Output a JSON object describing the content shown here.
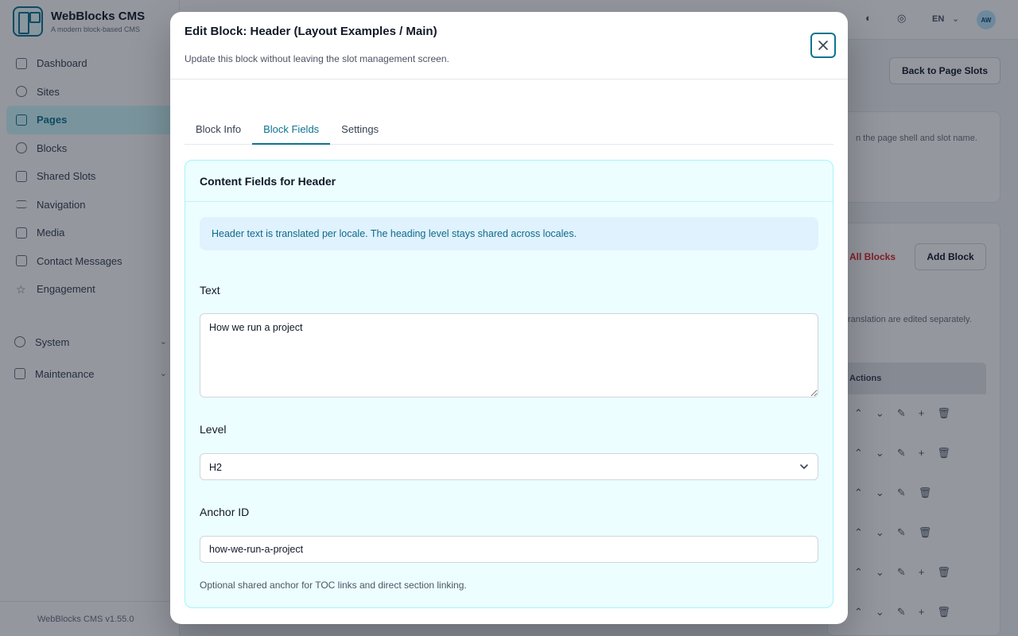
{
  "app": {
    "brand_name": "WebBlocks CMS",
    "brand_tagline": "A modern block-based CMS",
    "version": "WebBlocks CMS v1.55.0",
    "nav": [
      {
        "label": "Dashboard",
        "icon": "grid-icon"
      },
      {
        "label": "Sites",
        "icon": "globe-icon"
      },
      {
        "label": "Pages",
        "icon": "file-icon",
        "active": true
      },
      {
        "label": "Blocks",
        "icon": "blocks-icon"
      },
      {
        "label": "Shared Slots",
        "icon": "layers-icon"
      },
      {
        "label": "Navigation",
        "icon": "menu-icon"
      },
      {
        "label": "Media",
        "icon": "image-icon"
      },
      {
        "label": "Contact Messages",
        "icon": "mail-icon"
      },
      {
        "label": "Engagement",
        "icon": "star-icon"
      }
    ],
    "nav_groups": [
      {
        "label": "System"
      },
      {
        "label": "Maintenance"
      }
    ],
    "topbar": {
      "locale": "EN",
      "avatar_initials": "AW"
    },
    "page": {
      "back_button": "Back to Page Slots",
      "add_block_button": "Add Block",
      "all_blocks_link": "All Blocks",
      "shell_hint": "n the page shell and slot name.",
      "translation_hint": "ranslation are edited separately.",
      "actions_header": "Actions"
    }
  },
  "modal": {
    "title": "Edit Block: Header (Layout Examples / Main)",
    "description": "Update this block without leaving the slot management screen.",
    "tabs": [
      {
        "label": "Block Info",
        "active": false
      },
      {
        "label": "Block Fields",
        "active": true
      },
      {
        "label": "Settings",
        "active": false
      }
    ],
    "panel": {
      "heading": "Content Fields for Header",
      "info": "Header text is translated per locale. The heading level stays shared across locales.",
      "fields": {
        "text": {
          "label": "Text",
          "value": "How we run a project"
        },
        "level": {
          "label": "Level",
          "value": "H2"
        },
        "anchor": {
          "label": "Anchor ID",
          "value": "how-we-run-a-project",
          "help": "Optional shared anchor for TOC links and direct section linking."
        }
      }
    }
  },
  "colors": {
    "accent": "#0e7490",
    "panel_bg": "#ecfeff",
    "info_bg": "#e0f2fe"
  }
}
